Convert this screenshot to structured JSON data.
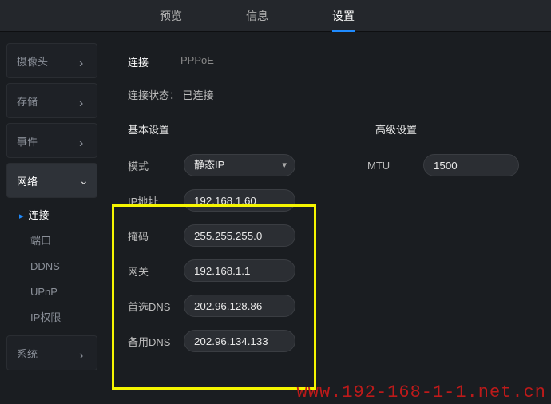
{
  "top_tabs": {
    "preview": "预览",
    "info": "信息",
    "settings": "设置"
  },
  "sidebar": {
    "camera": "摄像头",
    "storage": "存储",
    "event": "事件",
    "network": "网络",
    "system": "系统",
    "subs": {
      "connection": "连接",
      "port": "端口",
      "ddns": "DDNS",
      "upnp": "UPnP",
      "ip_permission": "IP权限"
    }
  },
  "sub_tabs": {
    "connection": "连接",
    "pppoe": "PPPoE"
  },
  "status_label": "连接状态：",
  "status_value": "已连接",
  "section": {
    "basic": "基本设置",
    "advanced": "高级设置"
  },
  "mode_label": "模式",
  "mode_value": "静态IP",
  "fields": {
    "ip_label": "IP地址",
    "ip_value": "192.168.1.60",
    "mask_label": "掩码",
    "mask_value": "255.255.255.0",
    "gateway_label": "网关",
    "gateway_value": "192.168.1.1",
    "dns1_label": "首选DNS",
    "dns1_value": "202.96.128.86",
    "dns2_label": "备用DNS",
    "dns2_value": "202.96.134.133"
  },
  "adv": {
    "mtu_label": "MTU",
    "mtu_value": "1500"
  },
  "watermark": "www.192-168-1-1.net.cn"
}
